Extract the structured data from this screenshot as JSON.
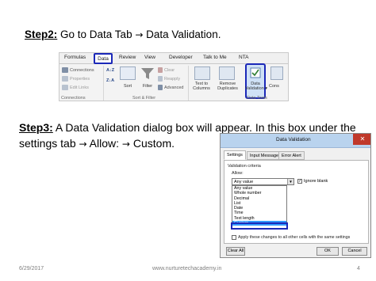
{
  "step2": {
    "label": "Step2:",
    "text_a": " Go to Data Tab ",
    "arrow": "→",
    "text_b": " Data Validation."
  },
  "ribbon": {
    "tabs": [
      "Formulas",
      "Data",
      "Review",
      "View",
      "Developer",
      "Talk to Me",
      "NTA"
    ],
    "connections": [
      "Connections",
      "Properties",
      "Edit Links"
    ],
    "connections_group": "Connections",
    "sort_az": "A↓Z",
    "sort_za": "Z↓A",
    "sort": "Sort",
    "filter": "Filter",
    "clear": "Clear",
    "reapply": "Reapply",
    "advanced": "Advanced",
    "sort_filter_group": "Sort & Filter",
    "text_to_columns": [
      "Text to",
      "Columns"
    ],
    "remove_duplicates": [
      "Remove",
      "Duplicates"
    ],
    "data_validation": [
      "Data",
      "Validation ▾"
    ],
    "cons": "Cons",
    "data_tools_group": "Data Tools"
  },
  "step3": {
    "label": "Step3:",
    "text_a": " A Data Validation dialog box will appear. In this box under the settings tab ",
    "arrow1": "→",
    "text_b": " Allow: ",
    "arrow2": "→",
    "text_c": " Custom."
  },
  "dialog": {
    "title": "Data Validation",
    "close": "✕",
    "tabs": [
      "Settings",
      "Input Message",
      "Error Alert"
    ],
    "criteria": "Validation criteria",
    "allow_label": "Allow:",
    "allow_value": "Any value",
    "ignore_blank": "Ignore blank",
    "ignore_checked": "✓",
    "options": [
      "Any value",
      "Whole number",
      "Decimal",
      "List",
      "Date",
      "Time",
      "Text length",
      "Custom"
    ],
    "apply_all": "Apply these changes to all other cells with the same settings",
    "clear_all": "Clear All",
    "ok": "OK",
    "cancel": "Cancel"
  },
  "footer": {
    "date": "6/29/2017",
    "url": "www.nurturetechacademy.in",
    "page": "4"
  },
  "colors": {
    "highlight": "#1b28b8",
    "selection": "#3399ff"
  }
}
